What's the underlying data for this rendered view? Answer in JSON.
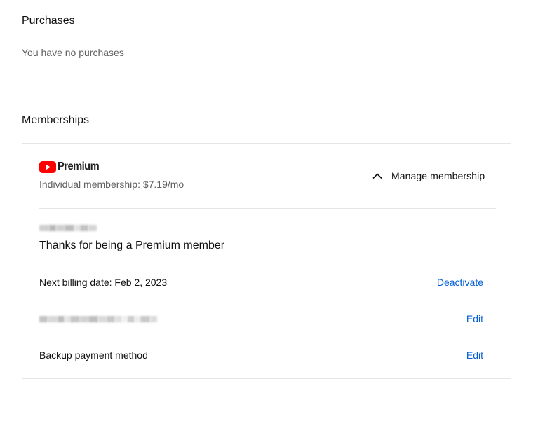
{
  "purchases": {
    "title": "Purchases",
    "empty_text": "You have no purchases"
  },
  "memberships": {
    "title": "Memberships",
    "card": {
      "logo_text": "Premium",
      "plan_text": "Individual membership: $7.19/mo",
      "manage_label": "Manage membership",
      "thanks_text": "Thanks for being a Premium member",
      "billing_text": "Next billing date: Feb 2, 2023",
      "deactivate_label": "Deactivate",
      "payment_edit_label": "Edit",
      "backup_label": "Backup payment method",
      "backup_edit_label": "Edit"
    }
  },
  "colors": {
    "youtube_red": "#ff0000",
    "link_blue": "#065fd4"
  }
}
